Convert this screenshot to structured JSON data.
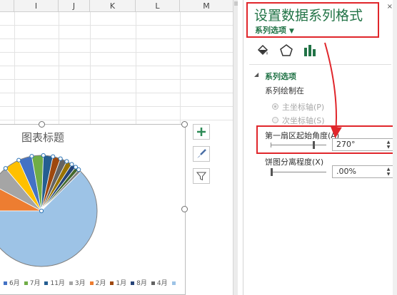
{
  "sheet": {
    "columns": [
      "I",
      "J",
      "K",
      "L",
      "M"
    ]
  },
  "chart": {
    "title": "图表标题",
    "tools": [
      {
        "name": "chart-elements-button",
        "icon": "plus-icon"
      },
      {
        "name": "chart-styles-button",
        "icon": "brush-icon"
      },
      {
        "name": "chart-filters-button",
        "icon": "filter-icon"
      }
    ],
    "legend": [
      {
        "label": "6月",
        "color": "#4472c4"
      },
      {
        "label": "7月",
        "color": "#70ad47"
      },
      {
        "label": "11月",
        "color": "#255e91"
      },
      {
        "label": "3月",
        "color": "#a5a5a5"
      },
      {
        "label": "2月",
        "color": "#ed7d31"
      },
      {
        "label": "1月",
        "color": "#9e480e"
      },
      {
        "label": "8月",
        "color": "#264478"
      },
      {
        "label": "4月",
        "color": "#636363"
      }
    ]
  },
  "pane": {
    "title": "设置数据系列格式",
    "dropdown_label": "系列选项",
    "close": "×",
    "section_title": "系列选项",
    "plot_on_label": "系列绘制在",
    "primary_axis": "主坐标轴(P)",
    "secondary_axis": "次坐标轴(S)",
    "angle_label": "第一扇区起始角度(A)",
    "angle_value": "270°",
    "explosion_label": "饼图分离程度(X)",
    "explosion_value": ".00%",
    "icons": {
      "fill": "paint-bucket-icon",
      "effects": "pentagon-icon",
      "series": "bar-chart-icon"
    },
    "accent": "#217346",
    "highlight": "#e0262b"
  }
}
